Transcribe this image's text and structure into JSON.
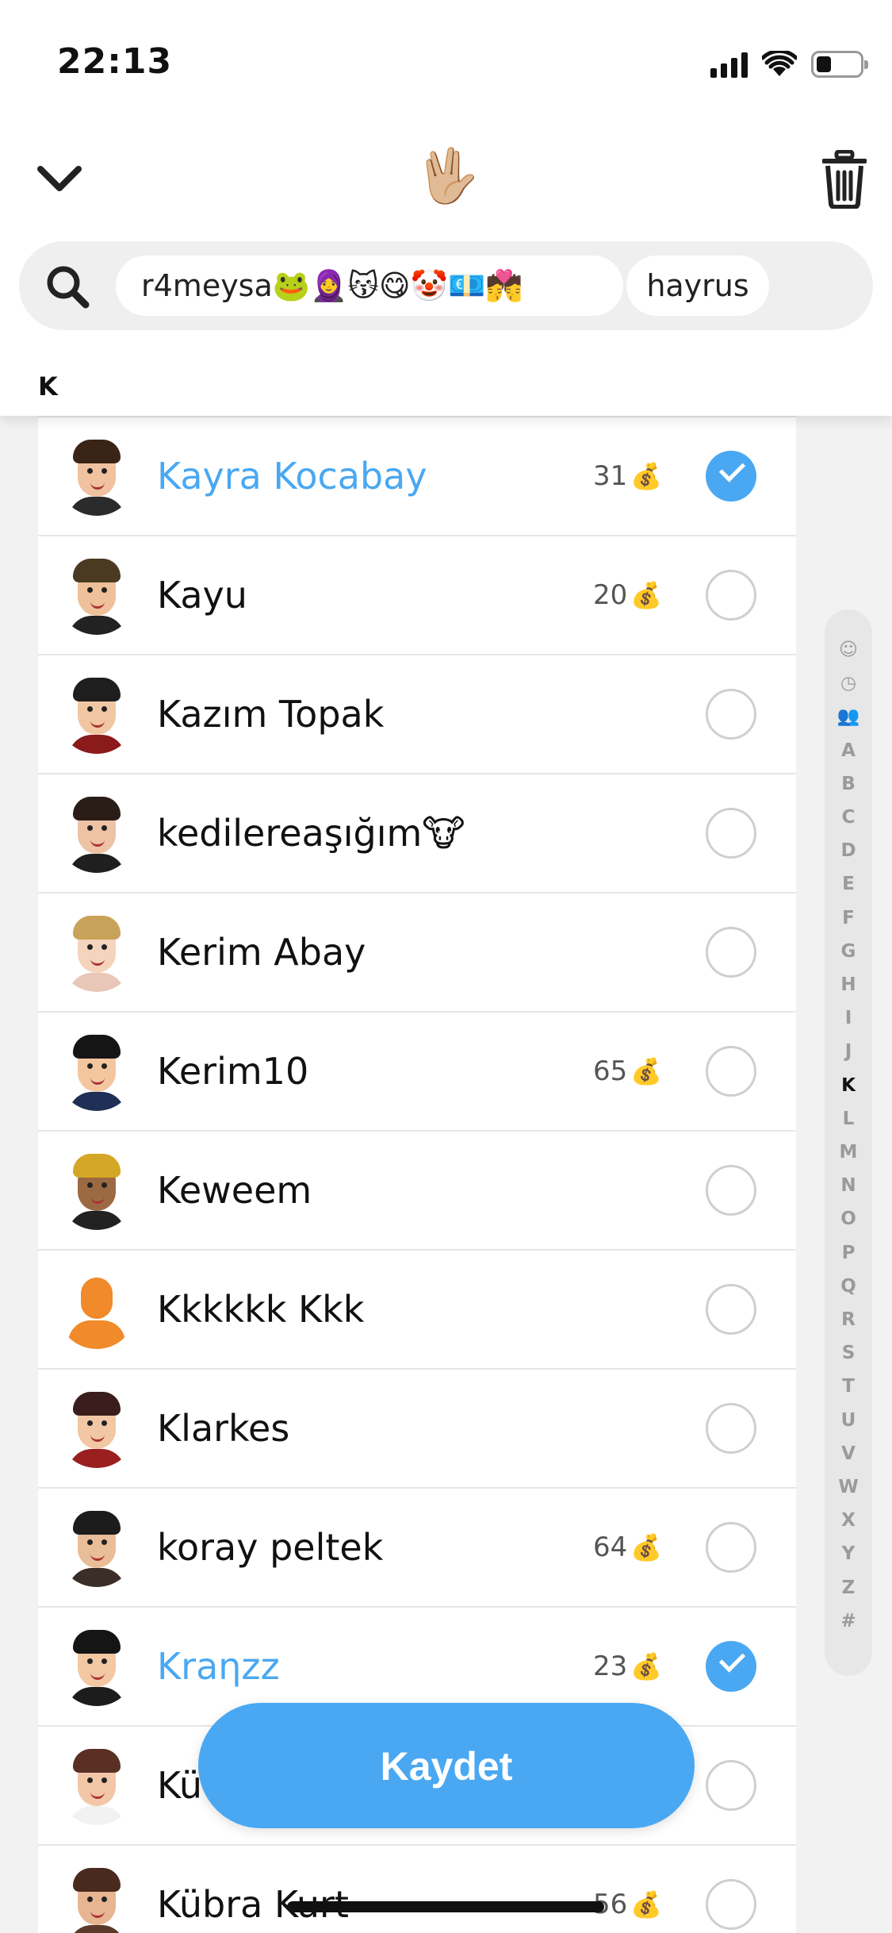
{
  "status_bar": {
    "time": "22:13",
    "icons": [
      "signal-icon",
      "wifi-icon",
      "battery-icon"
    ]
  },
  "nav": {
    "left_icon": "chevron-down-icon",
    "center_emoji": "🖖🏼",
    "right_icon": "trash-icon"
  },
  "search": {
    "icon": "search-icon",
    "chips": [
      {
        "label": "r4meysa🐸🧕😽😋🤡💶💏"
      },
      {
        "label": "hayrus"
      }
    ]
  },
  "section_header": "K",
  "friends": [
    {
      "name": "Kayra Kocabay",
      "score": "31",
      "score_emoji": "💰",
      "selected": true
    },
    {
      "name": "Kayu",
      "score": "20",
      "score_emoji": "💰",
      "selected": false
    },
    {
      "name": "Kazım Topak",
      "score": "",
      "score_emoji": "",
      "selected": false
    },
    {
      "name": "kedilereaşığım🐮",
      "score": "",
      "score_emoji": "",
      "selected": false
    },
    {
      "name": "Kerim Abay",
      "score": "",
      "score_emoji": "",
      "selected": false
    },
    {
      "name": "Kerim10",
      "score": "65",
      "score_emoji": "💰",
      "selected": false
    },
    {
      "name": "Keweem",
      "score": "",
      "score_emoji": "",
      "selected": false
    },
    {
      "name": "Kkkkkk Kkk",
      "score": "",
      "score_emoji": "",
      "selected": false
    },
    {
      "name": "Klarkes",
      "score": "",
      "score_emoji": "",
      "selected": false
    },
    {
      "name": "koray peltek",
      "score": "64",
      "score_emoji": "💰",
      "selected": false
    },
    {
      "name": "Kraηzz",
      "score": "23",
      "score_emoji": "💰",
      "selected": true
    },
    {
      "name": "Kü",
      "score": "",
      "score_emoji": "",
      "selected": false
    },
    {
      "name": "Kübra Kurt",
      "score": "56",
      "score_emoji": "💰",
      "selected": false
    }
  ],
  "alphabet_index": {
    "items": [
      "☺",
      "◷",
      "👥",
      "A",
      "B",
      "C",
      "D",
      "E",
      "F",
      "G",
      "H",
      "I",
      "J",
      "K",
      "L",
      "M",
      "N",
      "O",
      "P",
      "Q",
      "R",
      "S",
      "T",
      "U",
      "V",
      "W",
      "X",
      "Y",
      "Z",
      "#"
    ],
    "active": "K"
  },
  "save_button": {
    "label": "Kaydet"
  },
  "colors": {
    "accent": "#4aa8f2",
    "avatar_default": "#f08a2a"
  }
}
